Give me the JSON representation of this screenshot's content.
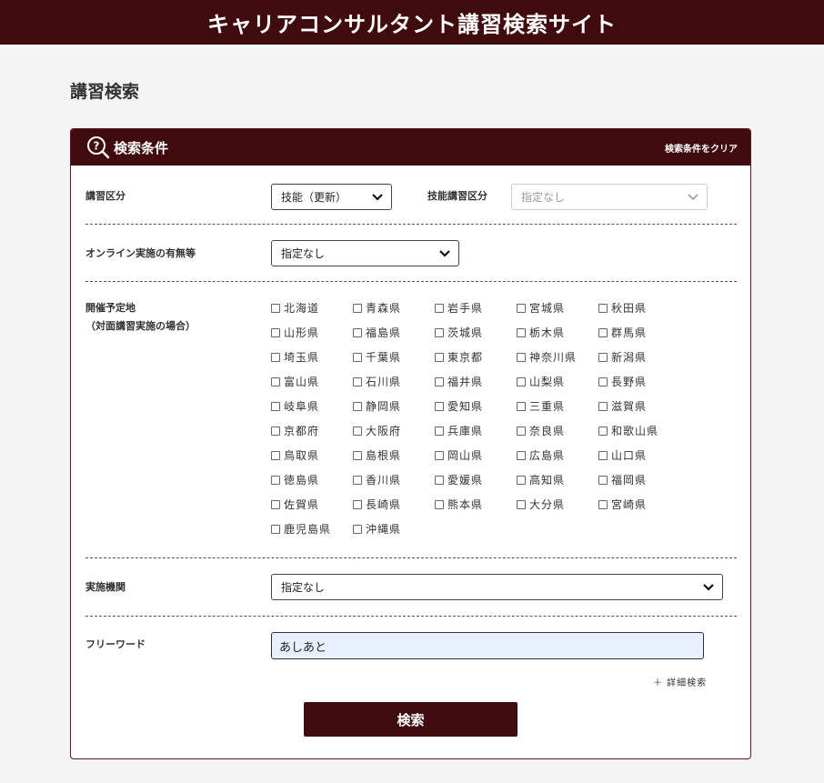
{
  "site": {
    "title": "キャリアコンサルタント講習検索サイト"
  },
  "page": {
    "title": "講習検索"
  },
  "panel": {
    "title": "検索条件",
    "clear_label": "検索条件をクリア"
  },
  "fields": {
    "course_type": {
      "label": "講習区分",
      "value": "技能（更新）"
    },
    "skill_course_type": {
      "label": "技能講習区分",
      "value": "指定なし"
    },
    "online": {
      "label": "オンライン実施の有無等",
      "value": "指定なし"
    },
    "location": {
      "label_line1": "開催予定地",
      "label_line2": "（対面講習実施の場合）"
    },
    "organization": {
      "label": "実施機関",
      "value": "指定なし"
    },
    "free_word": {
      "label": "フリーワード",
      "value": "あしあと"
    }
  },
  "prefectures": [
    "北海道",
    "青森県",
    "岩手県",
    "宮城県",
    "秋田県",
    "山形県",
    "福島県",
    "茨城県",
    "栃木県",
    "群馬県",
    "埼玉県",
    "千葉県",
    "東京都",
    "神奈川県",
    "新潟県",
    "富山県",
    "石川県",
    "福井県",
    "山梨県",
    "長野県",
    "岐阜県",
    "静岡県",
    "愛知県",
    "三重県",
    "滋賀県",
    "京都府",
    "大阪府",
    "兵庫県",
    "奈良県",
    "和歌山県",
    "鳥取県",
    "島根県",
    "岡山県",
    "広島県",
    "山口県",
    "徳島県",
    "香川県",
    "愛媛県",
    "高知県",
    "福岡県",
    "佐賀県",
    "長崎県",
    "熊本県",
    "大分県",
    "宮崎県",
    "鹿児島県",
    "沖縄県"
  ],
  "advanced_search_label": "＋ 詳細検索",
  "search_button_label": "検索",
  "colors": {
    "brand": "#3f0b0e",
    "background": "#f4f4f4",
    "input_fill": "#e8f0fe"
  }
}
